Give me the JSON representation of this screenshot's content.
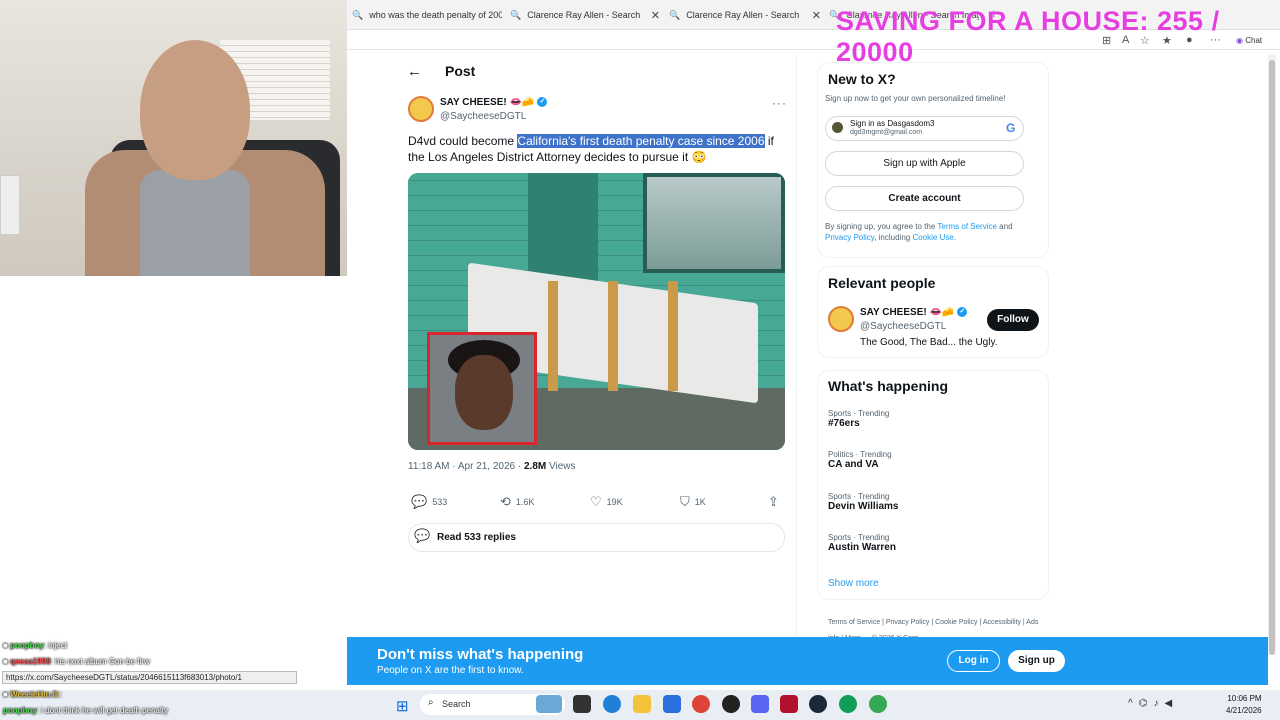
{
  "browser": {
    "tabs": [
      {
        "label": "who was the death penalty of 200"
      },
      {
        "label": "Clarence Ray Allen - Search"
      },
      {
        "label": "Clarence Ray Allen - Search"
      },
      {
        "label": "Clarence Ray Allen - Search Imag"
      }
    ],
    "toolbar_chat": "Chat"
  },
  "overlay": {
    "saving_text": "SAVING FOR A HOUSE: 255 / 20000"
  },
  "post": {
    "header_title": "Post",
    "display_name": "SAY CHEESE! 👄🧀",
    "handle": "@SaycheeseDGTL",
    "text_before": "D4vd could become ",
    "text_highlight": "California's first death penalty case since 2006",
    "text_after": " if the Los Angeles District Attorney decides to pursue it 😳",
    "time": "11:18 AM · Apr 21, 2026 · ",
    "views_count": "2.8M",
    "views_label": " Views",
    "replies": "533",
    "reposts": "1.6K",
    "likes": "19K",
    "bookmarks": "1K",
    "read_replies": "Read 533 replies"
  },
  "sidebar": {
    "new_title": "New to X?",
    "new_sub": "Sign up now to get your own personalized timeline!",
    "google_line1": "Sign in as Dasgasdom3",
    "google_line2": "dgd3mgmt@gmail.com",
    "apple_label": "Sign up with Apple",
    "create_label": "Create account",
    "terms_1": "By signing up, you agree to the ",
    "terms_tos": "Terms of Service",
    "terms_2": " and ",
    "terms_pp": "Privacy Policy",
    "terms_3": ", including ",
    "terms_cu": "Cookie Use",
    "terms_4": ".",
    "relevant_title": "Relevant people",
    "rel_name": "SAY CHEESE! 👄🧀",
    "rel_handle": "@SaycheeseDGTL",
    "rel_bio": "The Good, The Bad... the Ugly.",
    "follow_label": "Follow",
    "happening_title": "What's happening",
    "trends": [
      {
        "cat": "Sports · Trending",
        "name": "#76ers"
      },
      {
        "cat": "Politics · Trending",
        "name": "CA and VA"
      },
      {
        "cat": "Sports · Trending",
        "name": "Devin Williams"
      },
      {
        "cat": "Sports · Trending",
        "name": "Austin Warren"
      }
    ],
    "show_more": "Show more",
    "footer": "Terms of Service  |  Privacy Policy  |  Cookie Policy  |  Accessibility  |  Ads info  |  More ···  © 2026 X Corp."
  },
  "banner": {
    "title": "Don't miss what's happening",
    "sub": "People on X are the first to know.",
    "login": "Log in",
    "signup": "Sign up"
  },
  "chat": [
    {
      "user": "poopboy",
      "msg": ": inject"
    },
    {
      "user": "qeeaa1998",
      "msg": ": his next album Gon be firw"
    },
    {
      "user": "WeeeieHm.II:",
      "msg": ":"
    },
    {
      "user": "poopboy",
      "msg": ": i dont think he will get death penalty"
    }
  ],
  "status_url": "https://x.com/SaycheeseDGTL/status/2046615113f683013/photo/1",
  "taskbar": {
    "search": "Search",
    "time": "10:06 PM",
    "date": "4/21/2026"
  }
}
